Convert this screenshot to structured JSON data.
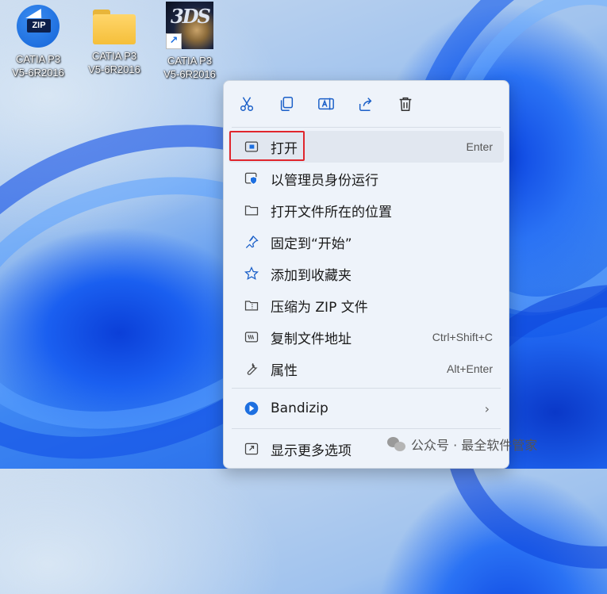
{
  "desktop": {
    "icons": [
      {
        "label_line1": "CATIA P3",
        "label_line2": "V5-6R2016",
        "icon": "bandizip-zip-icon",
        "badge": "ZIP"
      },
      {
        "label_line1": "CATIA P3",
        "label_line2": "V5-6R2016",
        "icon": "folder-icon"
      },
      {
        "label_line1": "CATIA P3",
        "label_line2": "V5-6R2016",
        "icon": "catia-3ds-shortcut-icon",
        "logo_text": "3DS"
      }
    ]
  },
  "context_menu": {
    "toolbar": [
      "cut-icon",
      "copy-icon",
      "rename-icon",
      "share-icon",
      "delete-icon"
    ],
    "items": [
      {
        "label": "打开",
        "shortcut": "Enter",
        "icon": "open-window-icon"
      },
      {
        "label": "以管理员身份运行",
        "shortcut": "",
        "icon": "admin-shield-icon"
      },
      {
        "label": "打开文件所在的位置",
        "shortcut": "",
        "icon": "folder-open-icon"
      },
      {
        "label": "固定到“开始”",
        "shortcut": "",
        "icon": "pin-icon"
      },
      {
        "label": "添加到收藏夹",
        "shortcut": "",
        "icon": "star-icon"
      },
      {
        "label": "压缩为 ZIP 文件",
        "shortcut": "",
        "icon": "zip-folder-icon"
      },
      {
        "label": "复制文件地址",
        "shortcut": "Ctrl+Shift+C",
        "icon": "copy-path-icon"
      },
      {
        "label": "属性",
        "shortcut": "Alt+Enter",
        "icon": "wrench-icon"
      }
    ],
    "bandizip": {
      "label": "Bandizip",
      "icon": "bandizip-icon"
    },
    "more": {
      "label": "显示更多选项",
      "icon": "more-options-icon"
    }
  },
  "watermark": {
    "text": "公众号 · 最全软件管家"
  },
  "colors": {
    "highlight_box": "#e0262d",
    "accent": "#1d6fe0"
  }
}
